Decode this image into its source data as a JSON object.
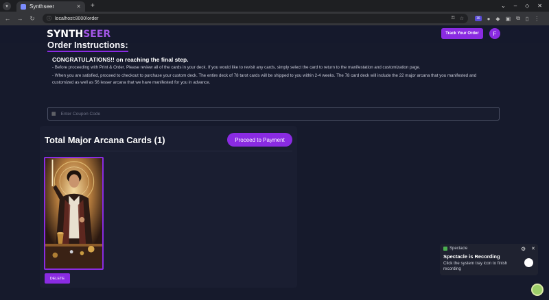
{
  "browser": {
    "tab_title": "Synthseer",
    "new_tab": "+",
    "url": "localhost:8000/order",
    "ext_badge": "16"
  },
  "header": {
    "logo_part1": "SYNTH",
    "logo_part2": "SEER",
    "track_order": "Track Your Order",
    "avatar_letter": "F"
  },
  "instructions": {
    "title": "Order Instructions:",
    "congrats": "CONGRATULATIONS!! on reaching the final step.",
    "line1": "- Before proceeding with Print & Order. Please review all of the cards in your deck. If you would like to revisit any cards, simply select the card to return to the manifestation and customization page.",
    "line2": "- When you are satisfied, proceed to checkout to purchase your custom deck. The entire deck of 78 tarot cards will be shipped to you within 2-4 weeks. The 78 card deck will include the 22 major arcana that you manifested and customized as well as 56 lesser arcana that we have manifested for you in advance."
  },
  "coupon": {
    "placeholder": "Enter Coupon Code",
    "value": ""
  },
  "cards": {
    "title": "Total Major Arcana Cards (1)",
    "proceed": "Proceed to Payment",
    "delete": "DELETE"
  },
  "notification": {
    "app": "Spectacle",
    "title": "Spectacle is Recording",
    "message": "Click the system tray icon to finish recording"
  },
  "colors": {
    "accent": "#8a2be2",
    "background": "#161a2c"
  }
}
